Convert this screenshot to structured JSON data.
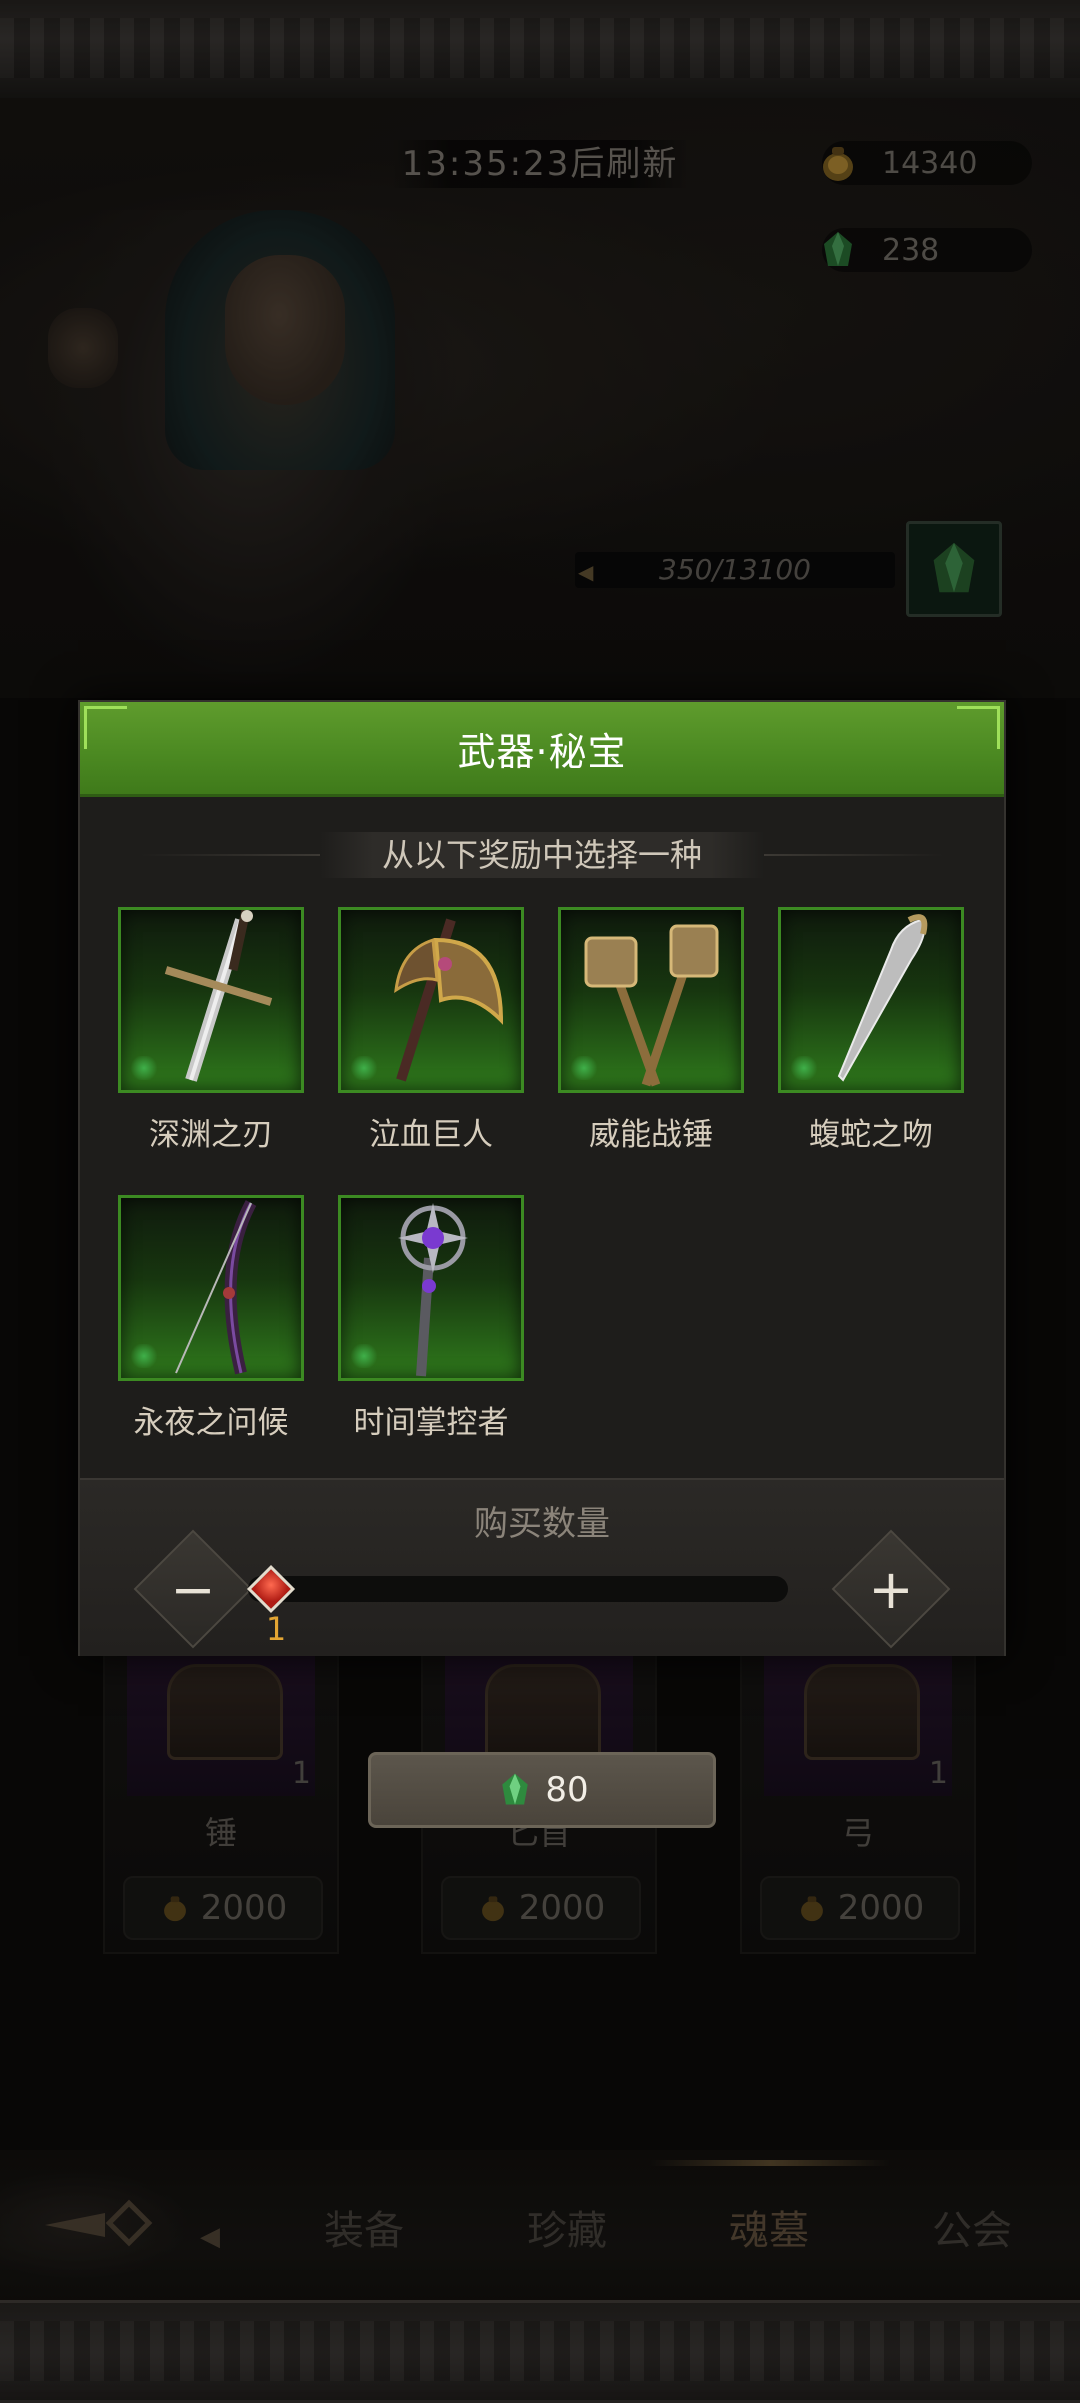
{
  "timer": {
    "text": "13:35:23后刷新"
  },
  "currency": [
    {
      "icon": "gold-pouch-icon",
      "value": "14340"
    },
    {
      "icon": "green-crystal-icon",
      "value": "238"
    }
  ],
  "progress": {
    "text": "350/13100"
  },
  "shop": {
    "cards": [
      {
        "name": "锤",
        "count": "1",
        "price": "2000"
      },
      {
        "name": "匕首",
        "count": "",
        "price": "2000"
      },
      {
        "name": "弓",
        "count": "1",
        "price": "2000"
      }
    ],
    "buy_price": "80"
  },
  "modal": {
    "title": "武器·秘宝",
    "subtitle": "从以下奖励中选择一种",
    "items": [
      {
        "label": "深渊之刃"
      },
      {
        "label": "泣血巨人"
      },
      {
        "label": "威能战锤"
      },
      {
        "label": "蝮蛇之吻"
      },
      {
        "label": "永夜之问候"
      },
      {
        "label": "时间掌控者"
      }
    ],
    "quantity": {
      "title": "购买数量",
      "value": "1",
      "minus": "−",
      "plus": "+"
    }
  },
  "nav": {
    "tabs": [
      {
        "label": "装备"
      },
      {
        "label": "珍藏"
      },
      {
        "label": "魂墓"
      },
      {
        "label": "公会"
      }
    ],
    "active": "魂墓"
  },
  "colors": {
    "accent_green": "#4c8a22",
    "gold": "#e3a533"
  }
}
